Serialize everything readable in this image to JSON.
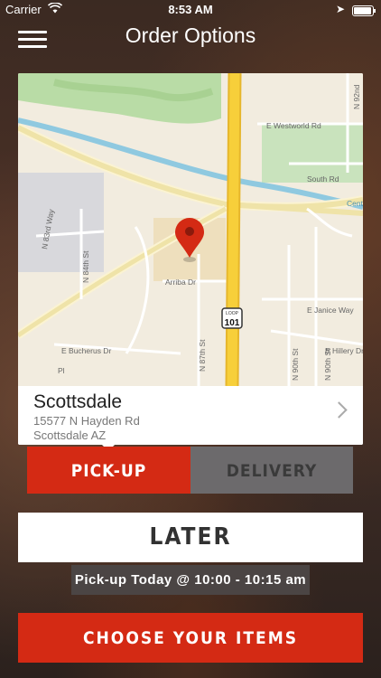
{
  "status_bar": {
    "carrier": "Carrier",
    "time": "8:53 AM"
  },
  "header": {
    "title": "Order Options",
    "menu_icon": "hamburger-menu-icon"
  },
  "map": {
    "labels": {
      "westworld": "E Westworld Rd",
      "south": "South Rd",
      "cent": "Cent",
      "n83rd": "N 83rd Way",
      "n84th": "N 84th St",
      "arriba": "Arriba Dr",
      "bucherus": "E Bucherus Dr",
      "n87th": "N 87th St",
      "janice": "E Janice Way",
      "hillery": "E Hillery Dr",
      "n90th": "N 90th St",
      "n90th2": "N 90th St",
      "n92nd": "N 92nd",
      "pl": "Pl",
      "loop_top": "LOOP",
      "loop_num": "101"
    },
    "colors": {
      "highway": "#f7cf3a",
      "canal": "#8fc9e0",
      "park": "#b9dca6",
      "pin": "#d42a14"
    }
  },
  "location": {
    "name": "Scottsdale",
    "address_line1": "15577 N Hayden Rd",
    "address_line2": "Scottsdale AZ"
  },
  "order_type": {
    "pickup_label": "PICK-UP",
    "delivery_label": "DELIVERY",
    "selected": "PICK-UP"
  },
  "timing": {
    "later_label": "LATER",
    "time_text": "Pick-up Today @ 10:00 - 10:15 am"
  },
  "actions": {
    "choose_label": "CHOOSE YOUR ITEMS"
  },
  "colors": {
    "accent": "#d42a14",
    "inactive_segment": "#6c6a6c"
  }
}
